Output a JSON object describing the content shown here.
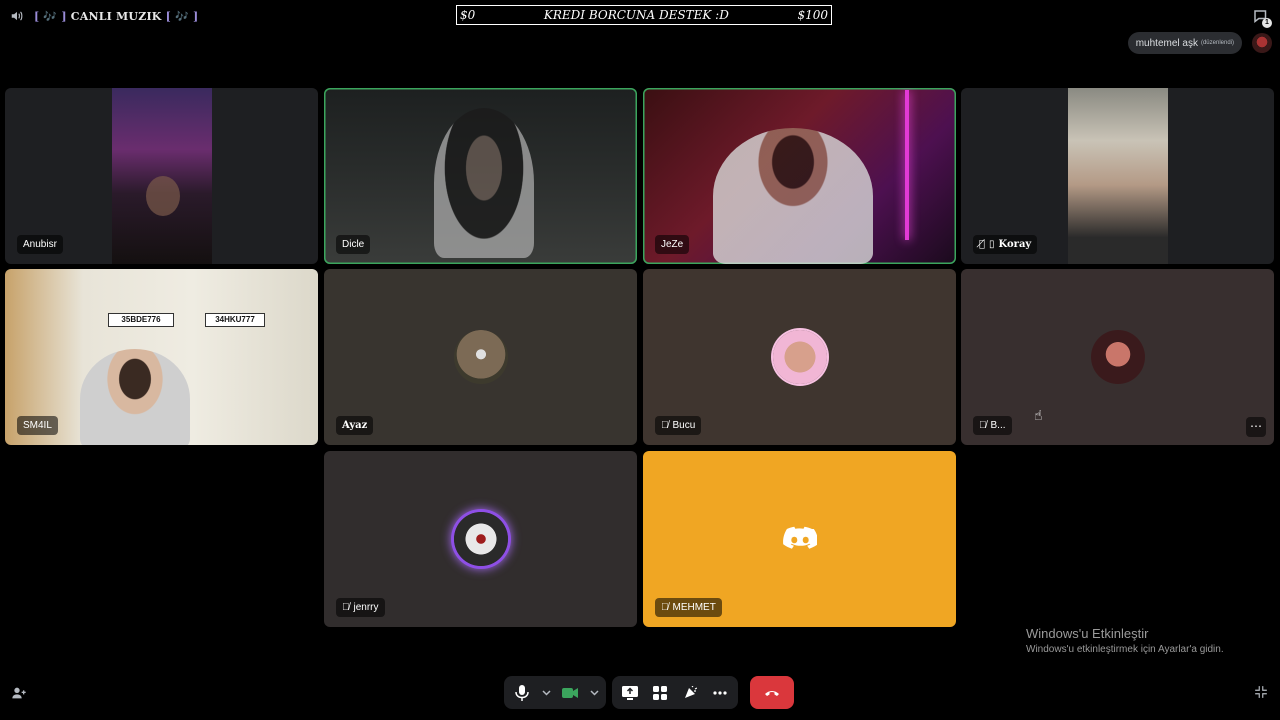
{
  "header": {
    "channel_name": "CANLI MUZIK",
    "channel_deco_left": "[ 🎶 ]",
    "channel_deco_right": "[ 🎶 ]"
  },
  "banner": {
    "left": "$0",
    "center": "KREDI BORCUNA DESTEK :D",
    "right": "$100"
  },
  "threads": {
    "badge": "1"
  },
  "status": {
    "text": "muhtemel aşk",
    "suffix": "(düzenlendi)"
  },
  "tiles": [
    {
      "name": "Anubisr",
      "muted": false
    },
    {
      "name": "Dicle",
      "muted": false,
      "speaking": true
    },
    {
      "name": "JeZe",
      "muted": false,
      "speaking": true
    },
    {
      "name": "Koray",
      "muted": true,
      "mobile": true
    },
    {
      "name": "SM4IL",
      "muted": false,
      "plates": [
        "35BDE776",
        "34HKU777"
      ]
    },
    {
      "name": "Ayaz",
      "muted": false
    },
    {
      "name": "Bucu",
      "muted": true
    },
    {
      "name": "B...",
      "muted": true
    },
    {
      "name": "jenrry",
      "muted": true
    },
    {
      "name": "MEHMET",
      "muted": true
    }
  ],
  "watermark": {
    "title": "Windows'u Etkinleştir",
    "subtitle": "Windows'u etkinleştirmek için Ayarlar'a gidin."
  },
  "colors": {
    "speaking": "#3ba55d",
    "end_call": "#da373c",
    "mehmet_tile": "#f0a623",
    "camera_on": "#3ba55d"
  },
  "icons": [
    "speaker-icon",
    "threads-icon",
    "mic-icon",
    "camera-icon",
    "share-screen-icon",
    "activities-icon",
    "soundboard-icon",
    "more-icon",
    "hangup-icon",
    "add-user-icon",
    "fullscreen-icon",
    "discord-logo-icon",
    "muted-mic-icon",
    "mobile-icon"
  ]
}
